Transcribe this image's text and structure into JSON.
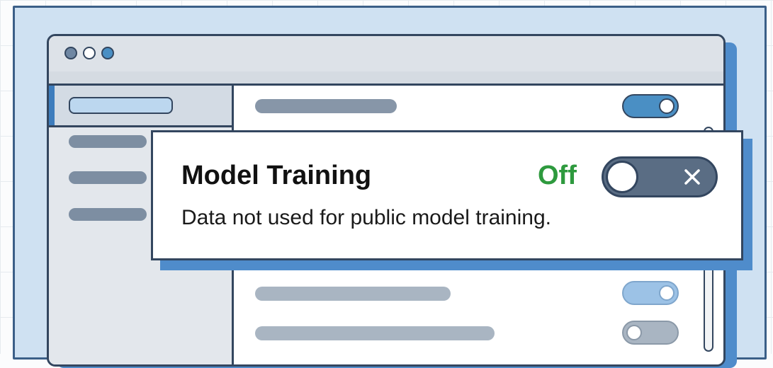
{
  "window": {
    "traffic_lights": [
      "close-dot",
      "minimize-dot",
      "maximize-dot"
    ],
    "accent_color": "#4f8ccb",
    "frame_color": "#33465f"
  },
  "setting": {
    "title": "Model Training",
    "status": "Off",
    "status_color": "#2e9a3e",
    "description": "Data not used for public model training.",
    "toggle_state": "off",
    "toggle_icon": "x-icon"
  },
  "background_rows": [
    {
      "toggle": "on"
    },
    {
      "toggle": "on"
    },
    {
      "toggle": "off"
    }
  ]
}
